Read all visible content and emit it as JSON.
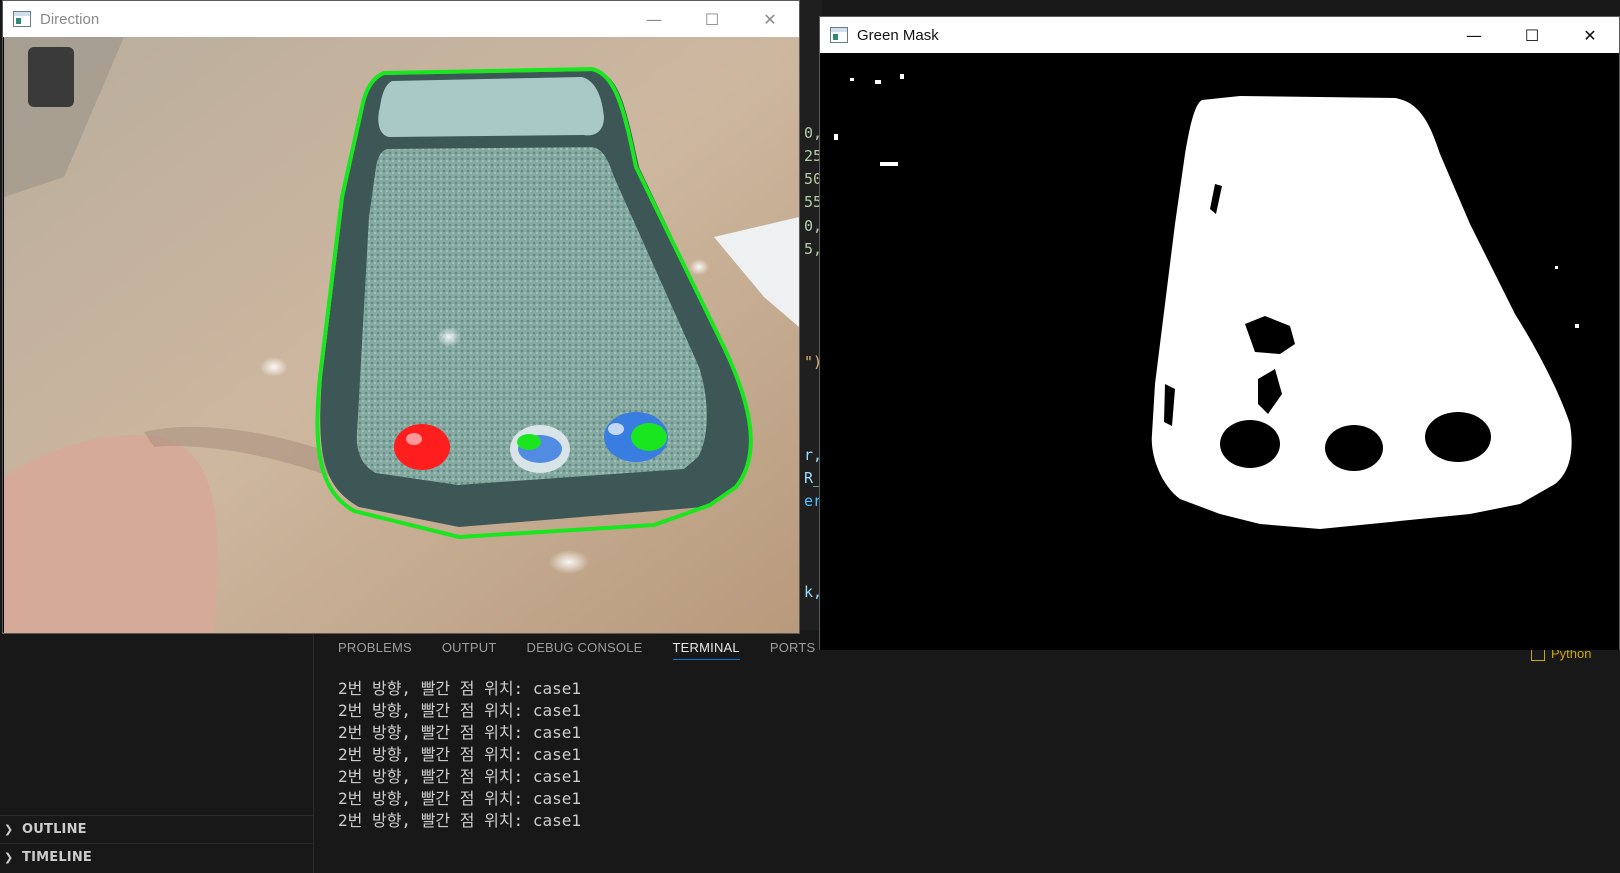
{
  "direction_window": {
    "title": "Direction",
    "controls": {
      "minimize": "—",
      "maximize": "☐",
      "close": "✕"
    }
  },
  "mask_window": {
    "title": "Green Mask",
    "controls": {
      "minimize": "—",
      "maximize": "☐",
      "close": "✕"
    }
  },
  "code_fragments": [
    {
      "text": "0,",
      "color": "#b5cea8"
    },
    {
      "text": "25",
      "color": "#b5cea8"
    },
    {
      "text": "50",
      "color": "#b5cea8"
    },
    {
      "text": "55",
      "color": "#b5cea8"
    },
    {
      "text": "0,",
      "color": "#b5cea8"
    },
    {
      "text": "5,",
      "color": "#b5cea8"
    },
    {
      "text": "\")",
      "color": "#d7ba7d"
    },
    {
      "text": "r,",
      "color": "#9cdcfe"
    },
    {
      "text": "R_",
      "color": "#9cdcfe"
    },
    {
      "text": "er",
      "color": "#4fc1ff"
    },
    {
      "text": "k,",
      "color": "#9cdcfe"
    }
  ],
  "panel": {
    "tabs": [
      "PROBLEMS",
      "OUTPUT",
      "DEBUG CONSOLE",
      "TERMINAL",
      "PORTS"
    ],
    "active_tab": "TERMINAL",
    "terminal_lines": [
      "2번 방향, 빨간 점 위치: case1",
      "2번 방향, 빨간 점 위치: case1",
      "2번 방향, 빨간 점 위치: case1",
      "2번 방향, 빨간 점 위치: case1",
      "2번 방향, 빨간 점 위치: case1",
      "2번 방향, 빨간 점 위치: case1",
      "2번 방향, 빨간 점 위치: case1"
    ]
  },
  "sidebar": {
    "sections": [
      {
        "label": "OUTLINE"
      },
      {
        "label": "TIMELINE"
      }
    ]
  },
  "status": {
    "python_label": "Python"
  },
  "colors": {
    "accent": "#0078d4",
    "contour_green": "#19e61e",
    "marker_red": "#ff1e1e",
    "marker_blue": "#3a7de0"
  }
}
